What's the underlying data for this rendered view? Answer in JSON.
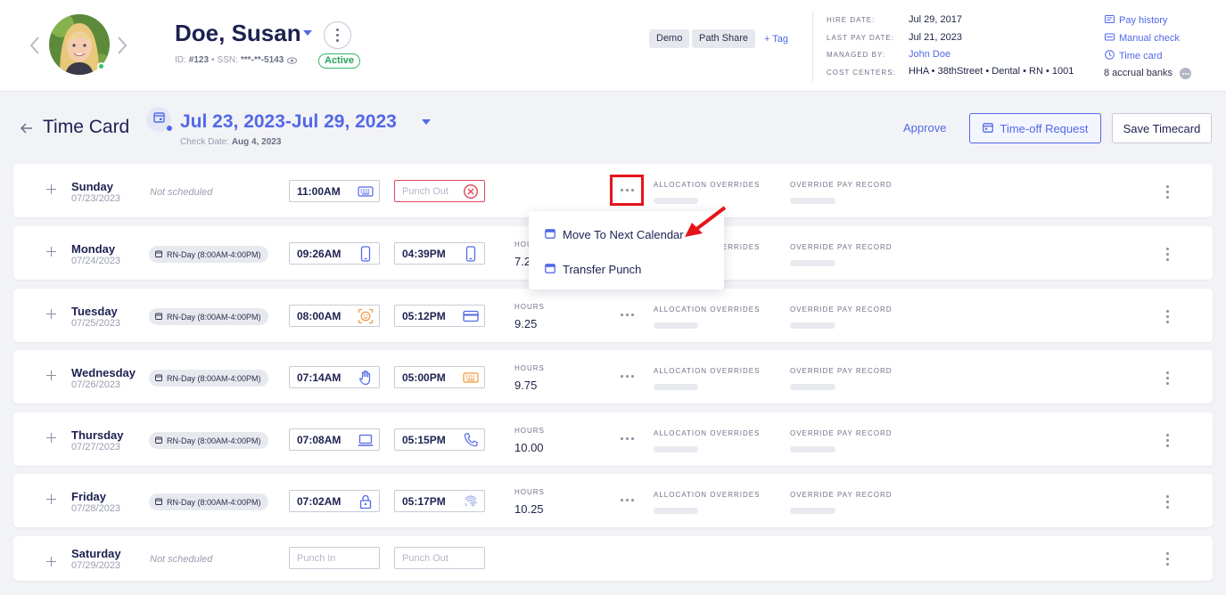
{
  "employee": {
    "name": "Doe, Susan",
    "id_label": "ID:",
    "id_value": "#123",
    "separator": "•",
    "ssn_label": "SSN:",
    "ssn_value": "***-**-5143",
    "status": "Active",
    "tags": [
      "Demo",
      "Path Share"
    ],
    "add_tag_label": "+ Tag"
  },
  "info": {
    "hire_date_label": "HIRE DATE:",
    "hire_date": "Jul 29, 2017",
    "last_pay_label": "LAST PAY DATE:",
    "last_pay": "Jul 21, 2023",
    "managed_by_label": "MANAGED BY:",
    "managed_by": "John Doe",
    "cost_centers_label": "COST CENTERS:",
    "cost_centers": "HHA • 38thStreet • Dental • RN • 1001"
  },
  "quick_links": {
    "pay_history": "Pay history",
    "manual_check": "Manual check",
    "time_card": "Time card",
    "accrual_banks": "8 accrual banks"
  },
  "timecard": {
    "title": "Time Card",
    "period": "Jul 23, 2023-Jul 29, 2023",
    "check_date_label": "Check Date:",
    "check_date": "Aug 4, 2023",
    "approve_label": "Approve",
    "timeoff_label": "Time-off Request",
    "save_label": "Save Timecard"
  },
  "columns": {
    "hours": "HOURS",
    "allocation": "ALLOCATION OVERRIDES",
    "override": "OVERRIDE PAY RECORD"
  },
  "days": [
    {
      "name": "Sunday",
      "date": "07/23/2023",
      "schedule": "Not scheduled",
      "punch_in": "11:00AM",
      "punch_in_icon": "keyboard-icon",
      "punch_out_placeholder": "Punch Out",
      "punch_out_icon": "error-circle-icon",
      "hours": ""
    },
    {
      "name": "Monday",
      "date": "07/24/2023",
      "schedule": "RN-Day (8:00AM-4:00PM)",
      "punch_in": "09:26AM",
      "punch_in_icon": "mobile-icon",
      "punch_out": "04:39PM",
      "punch_out_icon": "mobile-icon",
      "hours": "7.2"
    },
    {
      "name": "Tuesday",
      "date": "07/25/2023",
      "schedule": "RN-Day (8:00AM-4:00PM)",
      "punch_in": "08:00AM",
      "punch_in_icon": "face-scan-icon",
      "punch_out": "05:12PM",
      "punch_out_icon": "card-icon",
      "hours": "9.25"
    },
    {
      "name": "Wednesday",
      "date": "07/26/2023",
      "schedule": "RN-Day (8:00AM-4:00PM)",
      "punch_in": "07:14AM",
      "punch_in_icon": "hand-icon",
      "punch_out": "05:00PM",
      "punch_out_icon": "keyboard-icon",
      "hours": "9.75"
    },
    {
      "name": "Thursday",
      "date": "07/27/2023",
      "schedule": "RN-Day (8:00AM-4:00PM)",
      "punch_in": "07:08AM",
      "punch_in_icon": "laptop-icon",
      "punch_out": "05:15PM",
      "punch_out_icon": "phone-icon",
      "hours": "10.00"
    },
    {
      "name": "Friday",
      "date": "07/28/2023",
      "schedule": "RN-Day (8:00AM-4:00PM)",
      "punch_in": "07:02AM",
      "punch_in_icon": "lock-icon",
      "punch_out": "05:17PM",
      "punch_out_icon": "fingerprint-icon",
      "hours": "10.25"
    },
    {
      "name": "Saturday",
      "date": "07/29/2023",
      "schedule": "Not scheduled",
      "punch_in_placeholder": "Punch In",
      "punch_out_placeholder": "Punch Out"
    }
  ],
  "row_menu": {
    "items": [
      "Move To Next Calendar",
      "Transfer Punch"
    ]
  },
  "colors": {
    "accent": "#5268e8",
    "active_green": "#23a356",
    "error_red": "#e4455a",
    "highlight_red": "#e5141b",
    "orange_icon": "#f0963a"
  }
}
